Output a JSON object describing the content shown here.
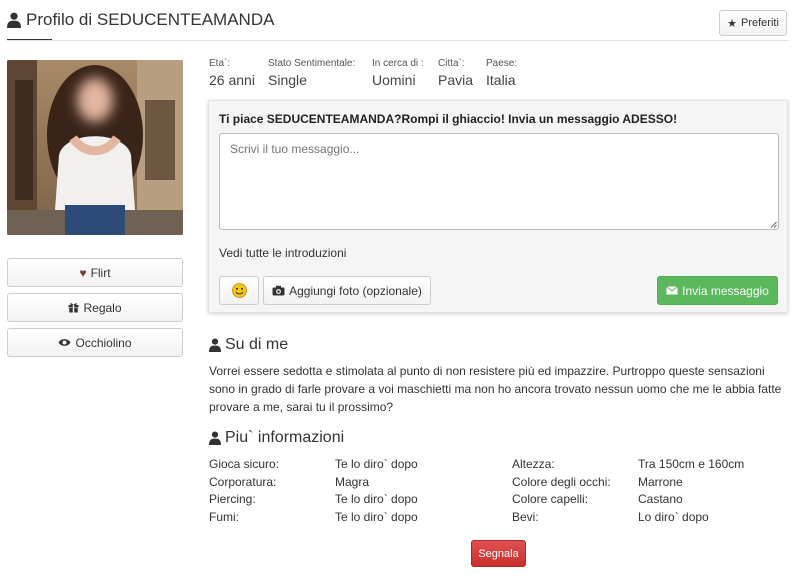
{
  "profile": {
    "title": "Profilo di SEDUCENTEAMANDA",
    "favorites_label": "Preferiti"
  },
  "actions": {
    "flirt_label": "Flirt",
    "gift_label": "Regalo",
    "wink_label": "Occhiolino"
  },
  "info": {
    "age_label": "Eta`:",
    "age_value": "26 anni",
    "status_label": "Stato Sentimentale:",
    "status_value": "Single",
    "seeking_label": "In cerca di :",
    "seeking_value": "Uomini",
    "city_label": "Citta`:",
    "city_value": "Pavia",
    "country_label": "Paese:",
    "country_value": "Italia"
  },
  "message": {
    "heading": "Ti piace SEDUCENTEAMANDA?Rompi il ghiaccio! Invia un messaggio ADESSO!",
    "placeholder": "Scrivi il tuo messaggio...",
    "intro_link": "Vedi tutte le introduzioni",
    "emoji_icon": "smiley-icon",
    "add_photo_label": "Aggiungi foto (opzionale)",
    "send_label": "Invia messaggio"
  },
  "about": {
    "title": "Su di me",
    "text": "Vorrei essere sedotta e stimolata al punto di non resistere più ed impazzire. Purtroppo queste sensazioni sono in grado di farle provare a voi maschietti ma non ho ancora trovato nessun uomo che me le abbia fatte provare a me, sarai tu il prossimo?"
  },
  "details": {
    "title": "Piu` informazioni",
    "left": [
      {
        "label": "Gioca sicuro:",
        "value": "Te lo diro` dopo"
      },
      {
        "label": "Corporatura:",
        "value": "Magra"
      },
      {
        "label": "Piercing:",
        "value": "Te lo diro` dopo"
      },
      {
        "label": "Fumi:",
        "value": "Te lo diro` dopo"
      }
    ],
    "right": [
      {
        "label": "Altezza:",
        "value": "Tra 150cm e 160cm"
      },
      {
        "label": "Colore degli occhi:",
        "value": "Marrone"
      },
      {
        "label": "Colore capelli:",
        "value": "Castano"
      },
      {
        "label": "Bevi:",
        "value": "Lo diro` dopo"
      }
    ]
  },
  "report_label": "Segnala",
  "colors": {
    "send_green": "#5cb85c",
    "report_red": "#c9302c",
    "heart": "#7a3b3b"
  }
}
